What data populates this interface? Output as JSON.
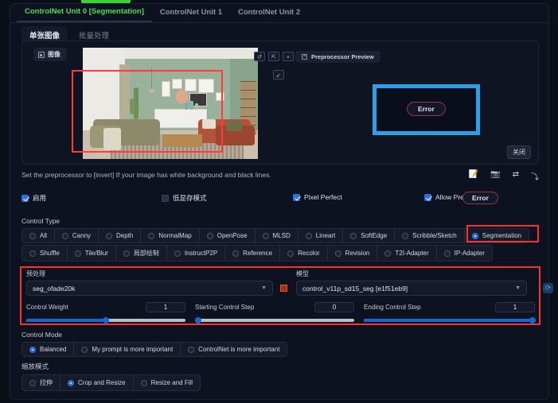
{
  "unit_tabs": [
    {
      "label": "ControlNet Unit 0 [Segmentation]",
      "active": true
    },
    {
      "label": "ControlNet Unit 1",
      "active": false
    },
    {
      "label": "ControlNet Unit 2",
      "active": false
    }
  ],
  "sub_tabs": [
    {
      "label": "单张图像",
      "active": true
    },
    {
      "label": "批量处理",
      "active": false
    }
  ],
  "image_panel": {
    "tab_chip_label": "图像",
    "tools": [
      "↺",
      "⇱",
      "×"
    ],
    "tool_extra": "↙",
    "preprocessor_preview_label": "Preprocessor Preview",
    "close_label": "关闭",
    "error_label": "Error"
  },
  "hint": {
    "text": "Set the preprocessor to [invert] If your image has white background and black lines.",
    "icons": [
      "📝",
      "📷",
      "⇄",
      "⤵"
    ]
  },
  "checkboxes": [
    {
      "label": "启用",
      "checked": true
    },
    {
      "label": "低显存模式",
      "checked": false
    },
    {
      "label": "Pixel Perfect",
      "checked": true
    },
    {
      "label": "Allow Preview",
      "checked": true
    }
  ],
  "allow_preview_error_label": "Error",
  "control_type": {
    "label": "Control Type",
    "row1": [
      {
        "label": "All",
        "selected": false
      },
      {
        "label": "Canny",
        "selected": false
      },
      {
        "label": "Depth",
        "selected": false
      },
      {
        "label": "NormalMap",
        "selected": false
      },
      {
        "label": "OpenPose",
        "selected": false
      },
      {
        "label": "MLSD",
        "selected": false
      },
      {
        "label": "Lineart",
        "selected": false
      },
      {
        "label": "SoftEdge",
        "selected": false
      },
      {
        "label": "Scribble/Sketch",
        "selected": false
      },
      {
        "label": "Segmentation",
        "selected": true
      }
    ],
    "row2": [
      {
        "label": "Shuffle",
        "selected": false
      },
      {
        "label": "Tile/Blur",
        "selected": false
      },
      {
        "label": "局部绘制",
        "selected": false
      },
      {
        "label": "InstructP2P",
        "selected": false
      },
      {
        "label": "Reference",
        "selected": false
      },
      {
        "label": "Recolor",
        "selected": false
      },
      {
        "label": "Revision",
        "selected": false
      },
      {
        "label": "T2I-Adapter",
        "selected": false
      },
      {
        "label": "IP-Adapter",
        "selected": false
      }
    ]
  },
  "preprocessor": {
    "label": "预处理",
    "value": "seg_ofade20k"
  },
  "model": {
    "label": "模型",
    "value": "control_v11p_sd15_seg [e1f51eb9]",
    "refresh_icon": "⟳"
  },
  "sliders": [
    {
      "label": "Control Weight",
      "value": "1",
      "percent": 50
    },
    {
      "label": "Starting Control Step",
      "value": "0",
      "percent": 0
    },
    {
      "label": "Ending Control Step",
      "value": "1",
      "percent": 100
    }
  ],
  "control_mode": {
    "label": "Control Mode",
    "options": [
      {
        "label": "Balanced",
        "selected": true
      },
      {
        "label": "My prompt is more important",
        "selected": false
      },
      {
        "label": "ControlNet is more important",
        "selected": false
      }
    ]
  },
  "resize_mode": {
    "label": "缩放模式",
    "options": [
      {
        "label": "拉伸",
        "selected": false
      },
      {
        "label": "Crop and Resize",
        "selected": true
      },
      {
        "label": "Resize and Fill",
        "selected": false
      }
    ]
  },
  "colors": {
    "accent_green": "#4ade57",
    "accent_blue": "#2f6fe0",
    "highlight_red": "#ff2f2f",
    "highlight_blue": "#2f9fe8",
    "error_border": "#8f3a3a"
  }
}
